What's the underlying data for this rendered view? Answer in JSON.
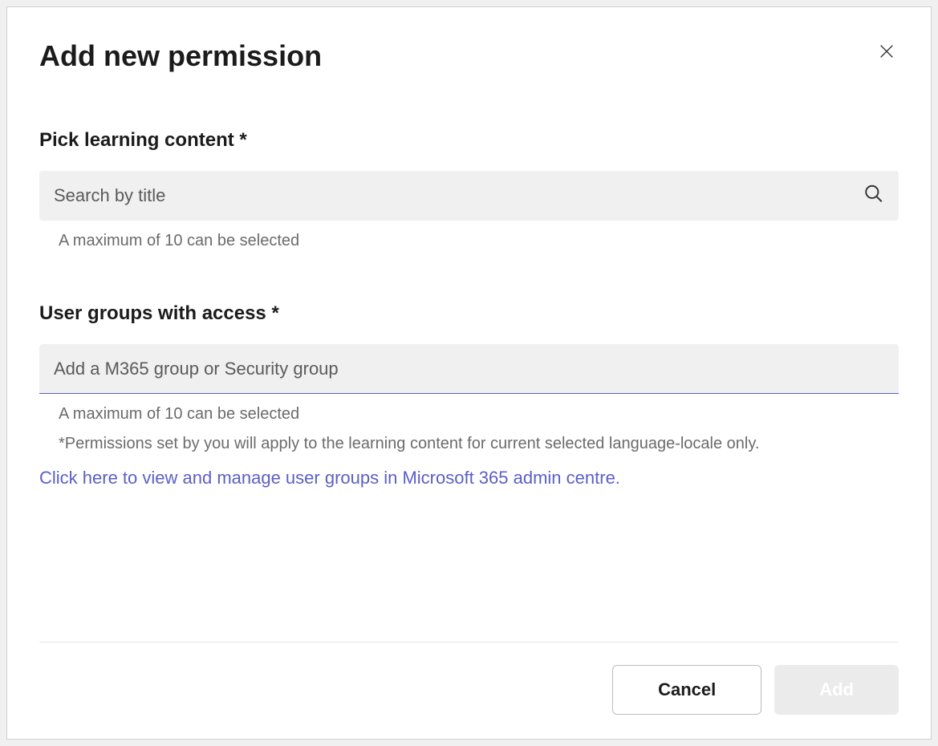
{
  "dialog": {
    "title": "Add new permission"
  },
  "fields": {
    "learning_content": {
      "label": "Pick learning content *",
      "placeholder": "Search by title",
      "helper": "A maximum of 10 can be selected"
    },
    "user_groups": {
      "label": "User groups with access *",
      "placeholder": "Add a M365 group or Security group",
      "helper": "A maximum of 10 can be selected",
      "note": "*Permissions set by you will apply to the learning content for current selected language-locale only."
    }
  },
  "link": "Click here to view and manage user groups in Microsoft 365 admin centre.",
  "buttons": {
    "cancel": "Cancel",
    "add": "Add"
  }
}
